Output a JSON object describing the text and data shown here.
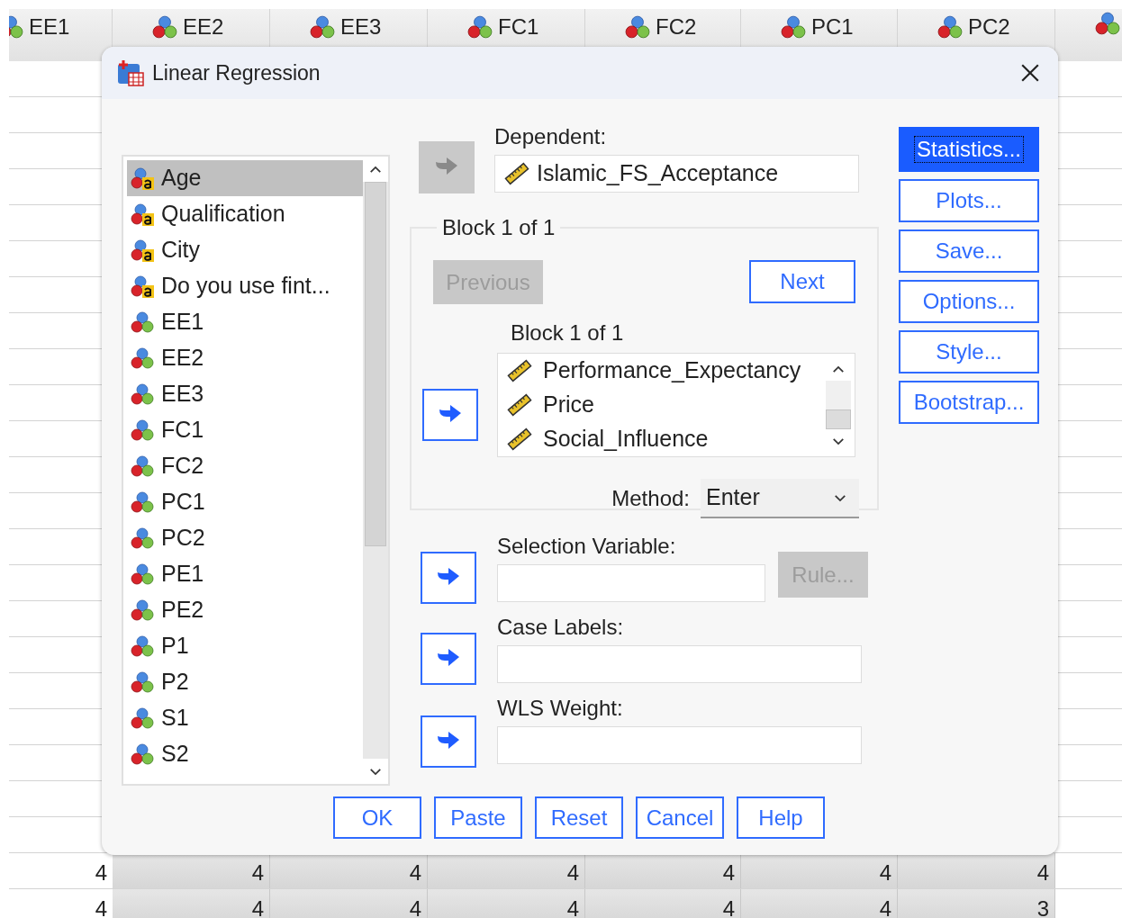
{
  "grid": {
    "columns": [
      {
        "label": "EE1"
      },
      {
        "label": "EE2"
      },
      {
        "label": "EE3"
      },
      {
        "label": "FC1"
      },
      {
        "label": "FC2"
      },
      {
        "label": "PC1"
      },
      {
        "label": "PC2"
      }
    ],
    "rows": [
      {
        "cells": [
          "4",
          "4",
          "4",
          "4",
          "4",
          "4",
          "4"
        ]
      },
      {
        "cells": [
          "4",
          "4",
          "4",
          "4",
          "4",
          "4",
          "3"
        ]
      }
    ]
  },
  "dialog": {
    "title": "Linear Regression",
    "variables": [
      {
        "name": "Age",
        "kind": "string",
        "selected": true
      },
      {
        "name": "Qualification",
        "kind": "string",
        "selected": false
      },
      {
        "name": "City",
        "kind": "string",
        "selected": false
      },
      {
        "name": "Do you use fint...",
        "kind": "string",
        "selected": false
      },
      {
        "name": "EE1",
        "kind": "nominal",
        "selected": false
      },
      {
        "name": "EE2",
        "kind": "nominal",
        "selected": false
      },
      {
        "name": "EE3",
        "kind": "nominal",
        "selected": false
      },
      {
        "name": "FC1",
        "kind": "nominal",
        "selected": false
      },
      {
        "name": "FC2",
        "kind": "nominal",
        "selected": false
      },
      {
        "name": "PC1",
        "kind": "nominal",
        "selected": false
      },
      {
        "name": "PC2",
        "kind": "nominal",
        "selected": false
      },
      {
        "name": "PE1",
        "kind": "nominal",
        "selected": false
      },
      {
        "name": "PE2",
        "kind": "nominal",
        "selected": false
      },
      {
        "name": "P1",
        "kind": "nominal",
        "selected": false
      },
      {
        "name": "P2",
        "kind": "nominal",
        "selected": false
      },
      {
        "name": "S1",
        "kind": "nominal",
        "selected": false
      },
      {
        "name": "S2",
        "kind": "nominal",
        "selected": false
      }
    ],
    "dependent": {
      "label": "Dependent:",
      "arrow_disabled": true,
      "value": {
        "name": "Islamic_FS_Acceptance",
        "kind": "scale"
      }
    },
    "block": {
      "legend": "Block 1 of 1",
      "previous": {
        "label": "Previous",
        "disabled": true
      },
      "next": {
        "label": "Next",
        "disabled": false
      },
      "inner_label": "Block 1 of 1",
      "arrow_disabled": false,
      "independents": [
        {
          "name": "Performance_Expectancy",
          "kind": "scale"
        },
        {
          "name": "Price",
          "kind": "scale"
        },
        {
          "name": "Social_Influence",
          "kind": "scale"
        }
      ],
      "method": {
        "label": "Method:",
        "value": "Enter"
      }
    },
    "selection": {
      "label": "Selection Variable:",
      "arrow_disabled": false,
      "rule": {
        "label": "Rule...",
        "disabled": true
      }
    },
    "case_labels": {
      "label": "Case Labels:",
      "arrow_disabled": false
    },
    "wls": {
      "label": "WLS Weight:",
      "arrow_disabled": false
    },
    "side_buttons": [
      {
        "label": "Statistics...",
        "selected": true
      },
      {
        "label": "Plots...",
        "selected": false
      },
      {
        "label": "Save...",
        "selected": false
      },
      {
        "label": "Options...",
        "selected": false
      },
      {
        "label": "Style...",
        "selected": false
      },
      {
        "label": "Bootstrap...",
        "selected": false
      }
    ],
    "bottom_buttons": [
      {
        "label": "OK"
      },
      {
        "label": "Paste"
      },
      {
        "label": "Reset"
      },
      {
        "label": "Cancel"
      },
      {
        "label": "Help"
      }
    ]
  }
}
